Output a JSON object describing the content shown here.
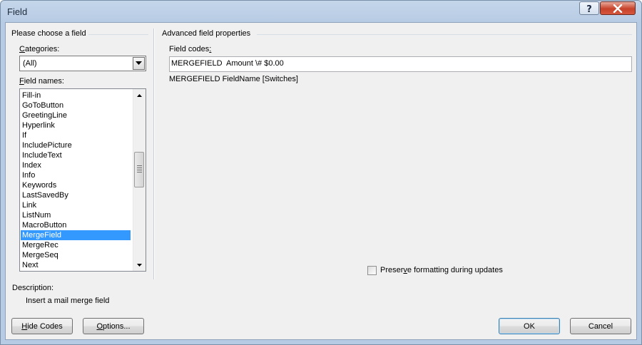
{
  "window": {
    "title": "Field"
  },
  "left_panel": {
    "group_title": "Please choose a field",
    "categories": {
      "label_prefix": "",
      "label_accel": "C",
      "label_rest": "ategories:",
      "selected": "(All)"
    },
    "field_names": {
      "label_accel": "F",
      "label_rest": "ield names:",
      "items": [
        "Fill-in",
        "GoToButton",
        "GreetingLine",
        "Hyperlink",
        "If",
        "IncludePicture",
        "IncludeText",
        "Index",
        "Info",
        "Keywords",
        "LastSavedBy",
        "Link",
        "ListNum",
        "MacroButton",
        "MergeField",
        "MergeRec",
        "MergeSeq",
        "Next"
      ],
      "selected": "MergeField"
    },
    "description": {
      "label": "Description:",
      "text": "Insert a mail merge field"
    }
  },
  "right_panel": {
    "group_title": "Advanced field properties",
    "field_codes": {
      "label": "Field codes",
      "label_suffix": ":",
      "value": "MERGEFIELD  Amount \\# $0.00",
      "syntax": "MERGEFIELD FieldName [Switches]"
    },
    "preserve": {
      "pre": "Preser",
      "accel": "v",
      "post": "e formatting during updates",
      "checked": false
    }
  },
  "buttons": {
    "hide_codes": {
      "accel": "H",
      "rest": "ide Codes"
    },
    "options": {
      "accel": "O",
      "rest": "ptions..."
    },
    "ok": "OK",
    "cancel": "Cancel"
  },
  "icons": {
    "help": "question-mark-icon",
    "close": "close-x-icon",
    "dropdown": "chevron-down-icon",
    "scroll_up": "scroll-up-arrow-icon",
    "scroll_down": "scroll-down-arrow-icon"
  }
}
